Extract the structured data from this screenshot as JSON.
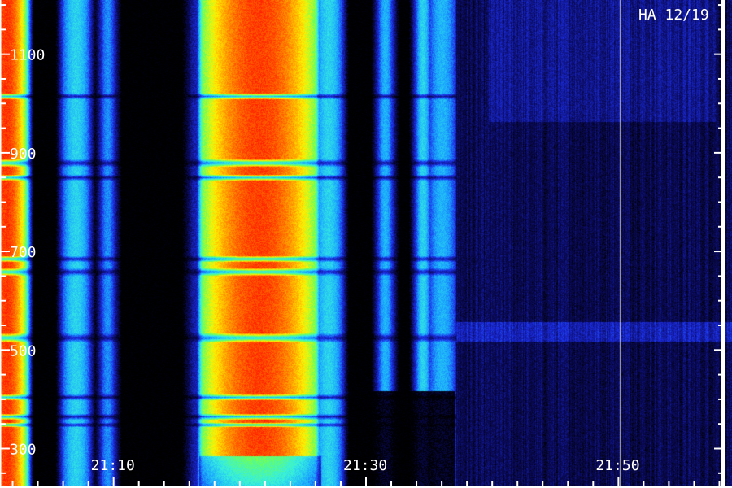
{
  "chart_data": {
    "type": "heatmap",
    "title": "HA 12/19",
    "xlabel": "",
    "ylabel": "",
    "colors": {
      "background": "#000000",
      "axis": "#ffffff",
      "colormap": [
        "#000000",
        "#0a0a5a",
        "#1c2ee6",
        "#1aa6ff",
        "#36f0e0",
        "#6cff5a",
        "#fff200",
        "#ff8a00",
        "#ff1a00"
      ]
    },
    "x_ticks": {
      "labels": [
        "21:10",
        "21:30",
        "21:50"
      ],
      "minutes": [
        10,
        30,
        50
      ],
      "minor_step_minutes": 2,
      "range_minutes": [
        1,
        59
      ]
    },
    "y_ticks": {
      "labels": [
        "1100",
        "900",
        "700",
        "500",
        "300"
      ],
      "values": [
        1100,
        900,
        700,
        500,
        300
      ],
      "minor_step": 50,
      "range": [
        220,
        1210
      ]
    },
    "activity": [
      {
        "start": "21:00",
        "end": "21:03",
        "intensity": 0.97,
        "note": "strong continuum"
      },
      {
        "start": "21:06",
        "end": "21:08",
        "intensity": 0.45
      },
      {
        "start": "21:09",
        "end": "21:10",
        "intensity": 0.35
      },
      {
        "start": "21:16",
        "end": "21:17",
        "intensity": 0.2
      },
      {
        "start": "21:17",
        "end": "21:26",
        "intensity": 0.96,
        "note": "strong continuum"
      },
      {
        "start": "21:26",
        "end": "21:28",
        "intensity": 0.45
      },
      {
        "start": "21:31",
        "end": "21:32",
        "intensity": 0.4
      },
      {
        "start": "21:34",
        "end": "21:35",
        "intensity": 0.45
      },
      {
        "start": "21:35",
        "end": "21:37",
        "intensity": 0.4
      }
    ]
  }
}
